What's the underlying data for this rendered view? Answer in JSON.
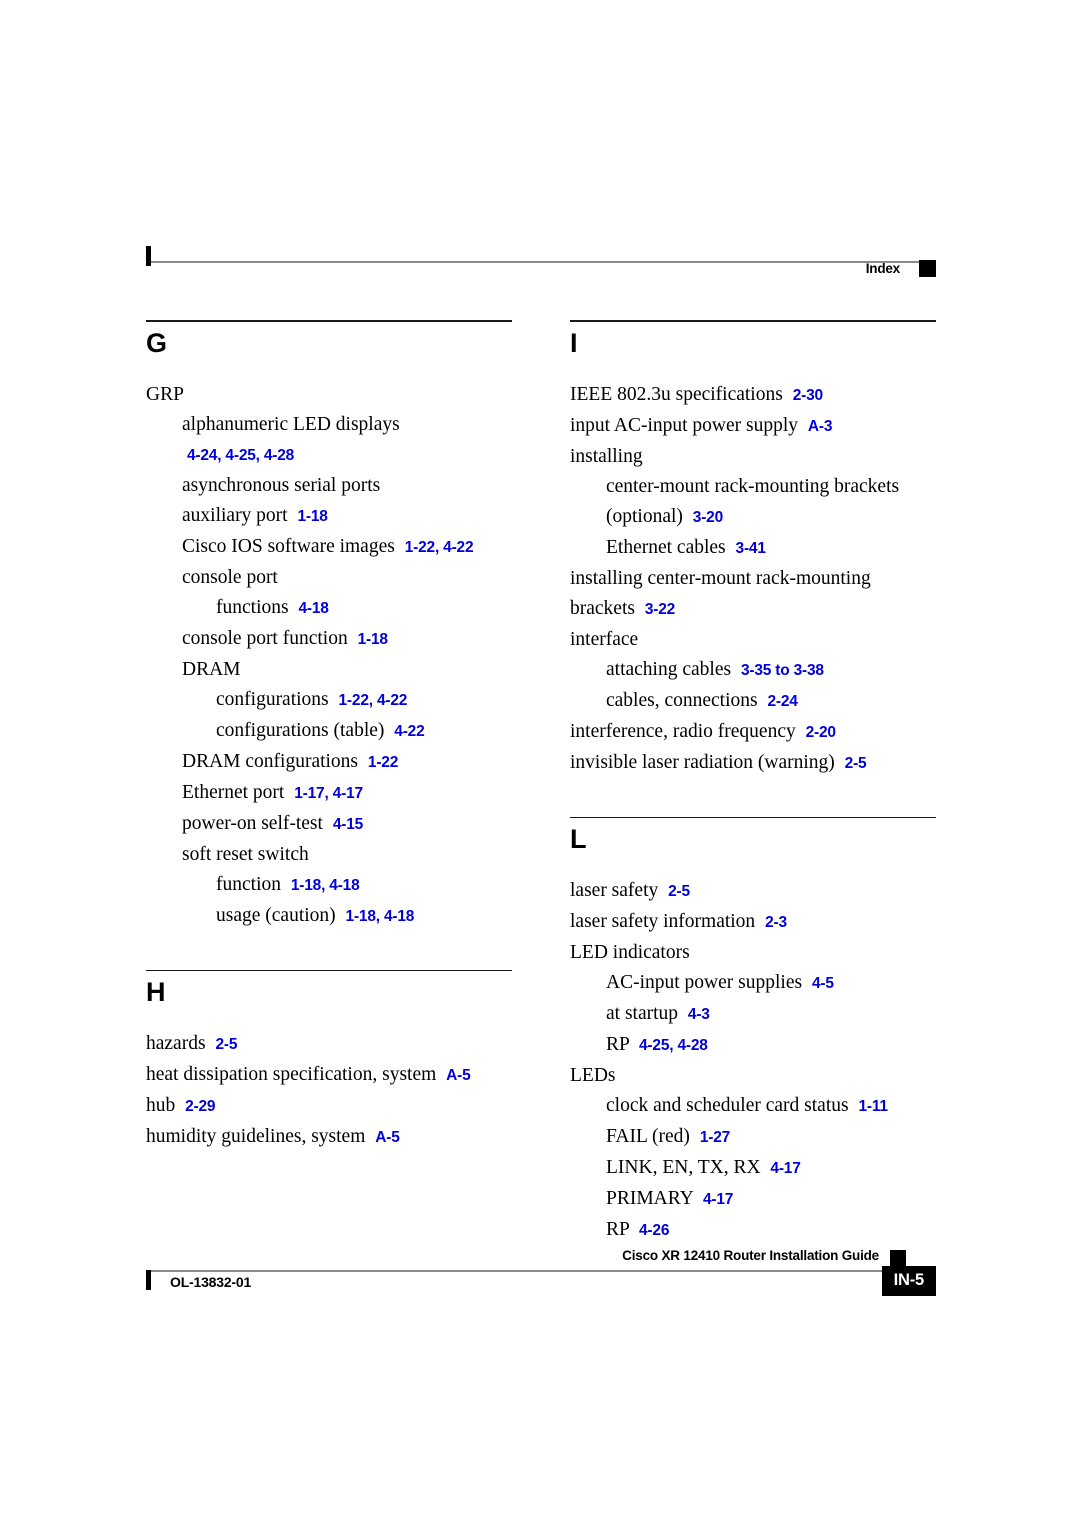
{
  "header": {
    "label": "Index"
  },
  "footer": {
    "doc_id": "OL-13832-01",
    "guide_title": "Cisco XR 12410 Router Installation Guide",
    "page_number": "IN-5"
  },
  "columns": [
    {
      "name": "left",
      "sections": [
        {
          "letter": "G",
          "entries": [
            {
              "level": 0,
              "text": "GRP",
              "refs": ""
            },
            {
              "level": 1,
              "text": "alphanumeric LED displays",
              "refs": "4-24, 4-25, 4-28"
            },
            {
              "level": 1,
              "text": "asynchronous serial ports",
              "refs": ""
            },
            {
              "level": 1,
              "text": "auxiliary port",
              "refs": "1-18"
            },
            {
              "level": 1,
              "text": "Cisco IOS software images",
              "refs": "1-22, 4-22"
            },
            {
              "level": 1,
              "text": "console port",
              "refs": ""
            },
            {
              "level": 2,
              "text": "functions",
              "refs": "4-18"
            },
            {
              "level": 1,
              "text": "console port function",
              "refs": "1-18"
            },
            {
              "level": 1,
              "text": "DRAM",
              "refs": ""
            },
            {
              "level": 2,
              "text": "configurations",
              "refs": "1-22, 4-22"
            },
            {
              "level": 2,
              "text": "configurations (table)",
              "refs": "4-22"
            },
            {
              "level": 1,
              "text": "DRAM configurations",
              "refs": "1-22"
            },
            {
              "level": 1,
              "text": "Ethernet port",
              "refs": "1-17, 4-17"
            },
            {
              "level": 1,
              "text": "power-on self-test",
              "refs": "4-15"
            },
            {
              "level": 1,
              "text": "soft reset switch",
              "refs": ""
            },
            {
              "level": 2,
              "text": "function",
              "refs": "1-18, 4-18"
            },
            {
              "level": 2,
              "text": "usage (caution)",
              "refs": "1-18, 4-18"
            }
          ]
        },
        {
          "letter": "H",
          "entries": [
            {
              "level": 0,
              "text": "hazards",
              "refs": "2-5"
            },
            {
              "level": 0,
              "text": "heat dissipation specification, system",
              "refs": "A-5"
            },
            {
              "level": 0,
              "text": "hub",
              "refs": "2-29"
            },
            {
              "level": 0,
              "text": "humidity guidelines, system",
              "refs": "A-5"
            }
          ]
        }
      ]
    },
    {
      "name": "right",
      "sections": [
        {
          "letter": "I",
          "entries": [
            {
              "level": 0,
              "text": "IEEE 802.3u specifications",
              "refs": "2-30"
            },
            {
              "level": 0,
              "text": "input AC-input power supply",
              "refs": "A-3"
            },
            {
              "level": 0,
              "text": "installing",
              "refs": ""
            },
            {
              "level": 1,
              "text": "center-mount rack-mounting brackets (optional)",
              "refs": "3-20"
            },
            {
              "level": 1,
              "text": "Ethernet cables",
              "refs": "3-41"
            },
            {
              "level": 0,
              "text": "installing center-mount rack-mounting brackets",
              "refs": "3-22"
            },
            {
              "level": 0,
              "text": "interface",
              "refs": ""
            },
            {
              "level": 1,
              "text": "attaching cables",
              "refs": "3-35 to 3-38"
            },
            {
              "level": 1,
              "text": "cables, connections",
              "refs": "2-24"
            },
            {
              "level": 0,
              "text": "interference, radio frequency",
              "refs": "2-20"
            },
            {
              "level": 0,
              "text": "invisible laser radiation (warning)",
              "refs": "2-5"
            }
          ]
        },
        {
          "letter": "L",
          "entries": [
            {
              "level": 0,
              "text": "laser safety",
              "refs": "2-5"
            },
            {
              "level": 0,
              "text": "laser safety information",
              "refs": "2-3"
            },
            {
              "level": 0,
              "text": "LED indicators",
              "refs": ""
            },
            {
              "level": 1,
              "text": "AC-input power supplies",
              "refs": "4-5"
            },
            {
              "level": 1,
              "text": "at startup",
              "refs": "4-3"
            },
            {
              "level": 1,
              "text": "RP",
              "refs": "4-25, 4-28"
            },
            {
              "level": 0,
              "text": "LEDs",
              "refs": ""
            },
            {
              "level": 1,
              "text": "clock and scheduler card status",
              "refs": "1-11"
            },
            {
              "level": 1,
              "text": "FAIL (red)",
              "refs": "1-27"
            },
            {
              "level": 1,
              "text": "LINK, EN, TX, RX",
              "refs": "4-17"
            },
            {
              "level": 1,
              "text": "PRIMARY",
              "refs": "4-17"
            },
            {
              "level": 1,
              "text": "RP",
              "refs": "4-26"
            }
          ]
        }
      ]
    }
  ],
  "colors": {
    "page_reference_blue": "#0000dd",
    "text_black": "#000000",
    "rule_gray": "#8a8a8a"
  }
}
